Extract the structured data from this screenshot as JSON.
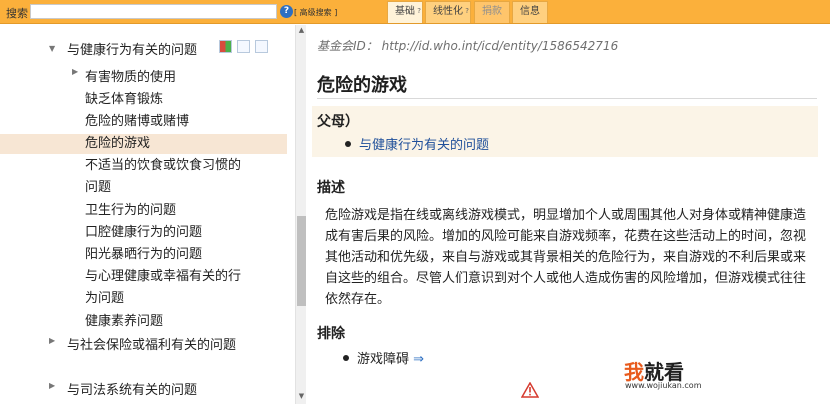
{
  "top": {
    "search_label": "搜索",
    "search_value": "",
    "advanced_search": "[ 高级搜索 ]",
    "tabs": [
      "基础",
      "线性化",
      "捐款",
      "信息"
    ]
  },
  "tree": {
    "items": [
      {
        "label": "与健康行为有关的问题",
        "expanded": true
      },
      {
        "label": "有害物质的使用",
        "collapsed": true
      },
      {
        "label": "缺乏体育锻炼"
      },
      {
        "label": "危险的赌博或赌博"
      },
      {
        "label": "危险的游戏",
        "selected": true
      },
      {
        "label": "不适当的饮食或饮食习惯的"
      },
      {
        "label": "问题"
      },
      {
        "label": "卫生行为的问题"
      },
      {
        "label": "口腔健康行为的问题"
      },
      {
        "label": "阳光暴晒行为的问题"
      },
      {
        "label": "与心理健康或幸福有关的行"
      },
      {
        "label": "为问题"
      },
      {
        "label": "健康素养问题"
      },
      {
        "label": "与社会保险或福利有关的问题",
        "collapsed": true
      },
      {
        "label": "与司法系统有关的问题",
        "collapsed": true
      }
    ]
  },
  "detail": {
    "foundation_uri": "基金会ID： http://id.who.int/icd/entity/1586542716",
    "title": "危险的游戏",
    "parent_heading": "父母）",
    "parent_link": "与健康行为有关的问题",
    "description_heading": "描述",
    "description": "危险游戏是指在线或离线游戏模式，明显增加个人或周围其他人对身体或精神健康造成有害后果的风险。增加的风险可能来自游戏频率，花费在这些活动上的时间，忽视其他活动和优先级，来自与游戏或其背景相关的危险行为，来自游戏的不利后果或来自这些的组合。尽管人们意识到对个人或他人造成伤害的风险增加，但游戏模式往往依然存在。",
    "exclusion_heading": "排除",
    "exclusion_item": "游戏障碍",
    "exclusion_arrow": "⇒"
  },
  "watermark": {
    "logo_first": "我",
    "logo_rest": "就看",
    "url": "www.wojiukan.com"
  }
}
